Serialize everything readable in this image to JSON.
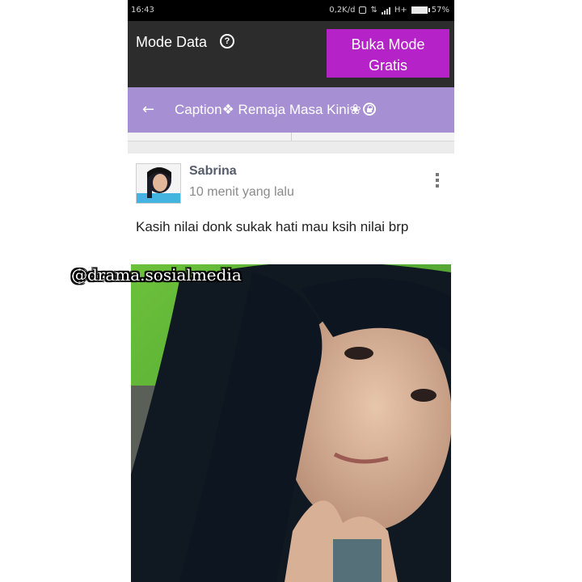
{
  "status_bar": {
    "time": "16:43",
    "net_speed": "0,2K/d",
    "network": "H+",
    "battery": "57%"
  },
  "data_mode": {
    "label": "Mode Data",
    "help_icon": "question-circle-icon",
    "free_button_label": "Buka Mode Gratis",
    "free_button_color": "#b522c7"
  },
  "group": {
    "back_icon": "arrow-left-icon",
    "title": "Caption❖ Remaja Masa Kini❀",
    "bar_color": "#a68fd2"
  },
  "post": {
    "author": "Sabrina",
    "time_ago": "10 menit yang lalu",
    "text": "Kasih nilai donk sukak hati mau ksih nilai brp",
    "menu_icon": "more-vertical-icon",
    "photo": "selfie-photo"
  },
  "watermark": "@drama.sosialmedia"
}
